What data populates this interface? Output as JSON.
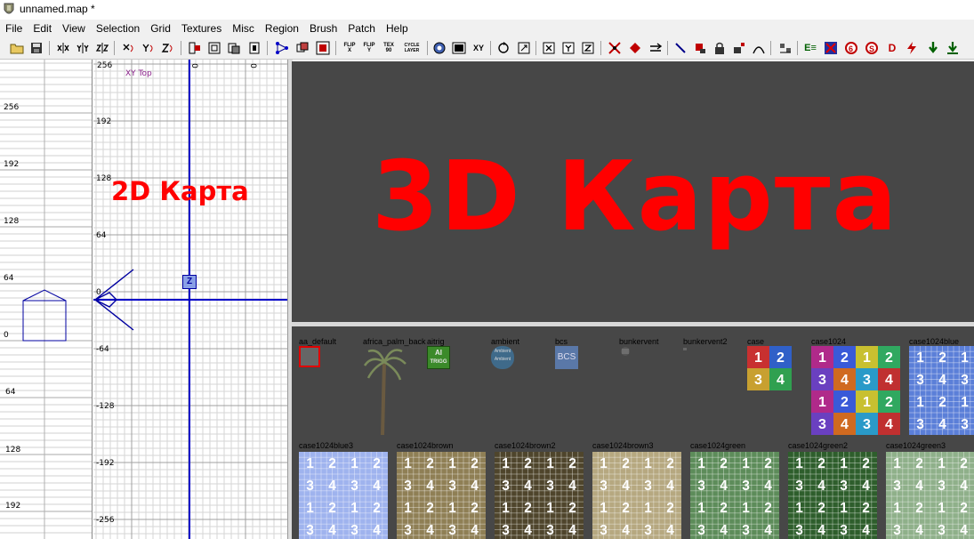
{
  "window": {
    "title": "unnamed.map *"
  },
  "menu": [
    "File",
    "Edit",
    "View",
    "Selection",
    "Grid",
    "Textures",
    "Misc",
    "Region",
    "Brush",
    "Patch",
    "Help"
  ],
  "toolbar_text": {
    "flip_x": "FLIP X",
    "flip_y": "FLIP Y",
    "tex_90": "TEX 90",
    "cycle_layer": "CYCLE LAYER",
    "xy": "XY",
    "e_label": "E≡",
    "d_label": "D"
  },
  "side_view": {
    "ticks": [
      "256",
      "192",
      "128",
      "64",
      "0",
      "64",
      "128",
      "192"
    ]
  },
  "top_view": {
    "top_ticks": [
      "256",
      "0",
      "0"
    ],
    "left_ticks": [
      "192",
      "128",
      "64",
      "0",
      "-64",
      "-128",
      "-192",
      "-256"
    ],
    "view_label": "XY Top",
    "z_marker": "Z",
    "overlay": "2D Карта"
  },
  "camera_view": {
    "overlay": "3D Карта"
  },
  "texture_browser": {
    "row1": [
      "aa_default",
      "africa_palm_back",
      "aitrig",
      "ambient",
      "bcs",
      "bunkervent",
      "bunkervent2",
      "case",
      "case1024",
      "case1024blue"
    ],
    "row2": [
      "case1024blue3",
      "case1024brown",
      "case1024brown2",
      "case1024brown3",
      "case1024green",
      "case1024green2",
      "case1024green3"
    ],
    "aitrig_text": [
      "AI",
      "TRIGG"
    ],
    "ambient_text": [
      "Ambient",
      "Ambient"
    ],
    "bcs_text": "BCS",
    "grid_digits": [
      "1",
      "2",
      "3",
      "4"
    ]
  },
  "colors": {
    "overlay_red": "#ff0000",
    "view_bg": "#474747",
    "axis_blue": "#0000c8",
    "selection_red": "#e00000",
    "blue": "#5b7fd8",
    "blue3": "#9fb3ee",
    "brown": "#8f7f55",
    "brown2": "#4f452c",
    "brown3": "#b6a880",
    "green": "#5d8c5a",
    "green2": "#2e5e2c",
    "green3": "#8fb08a"
  }
}
